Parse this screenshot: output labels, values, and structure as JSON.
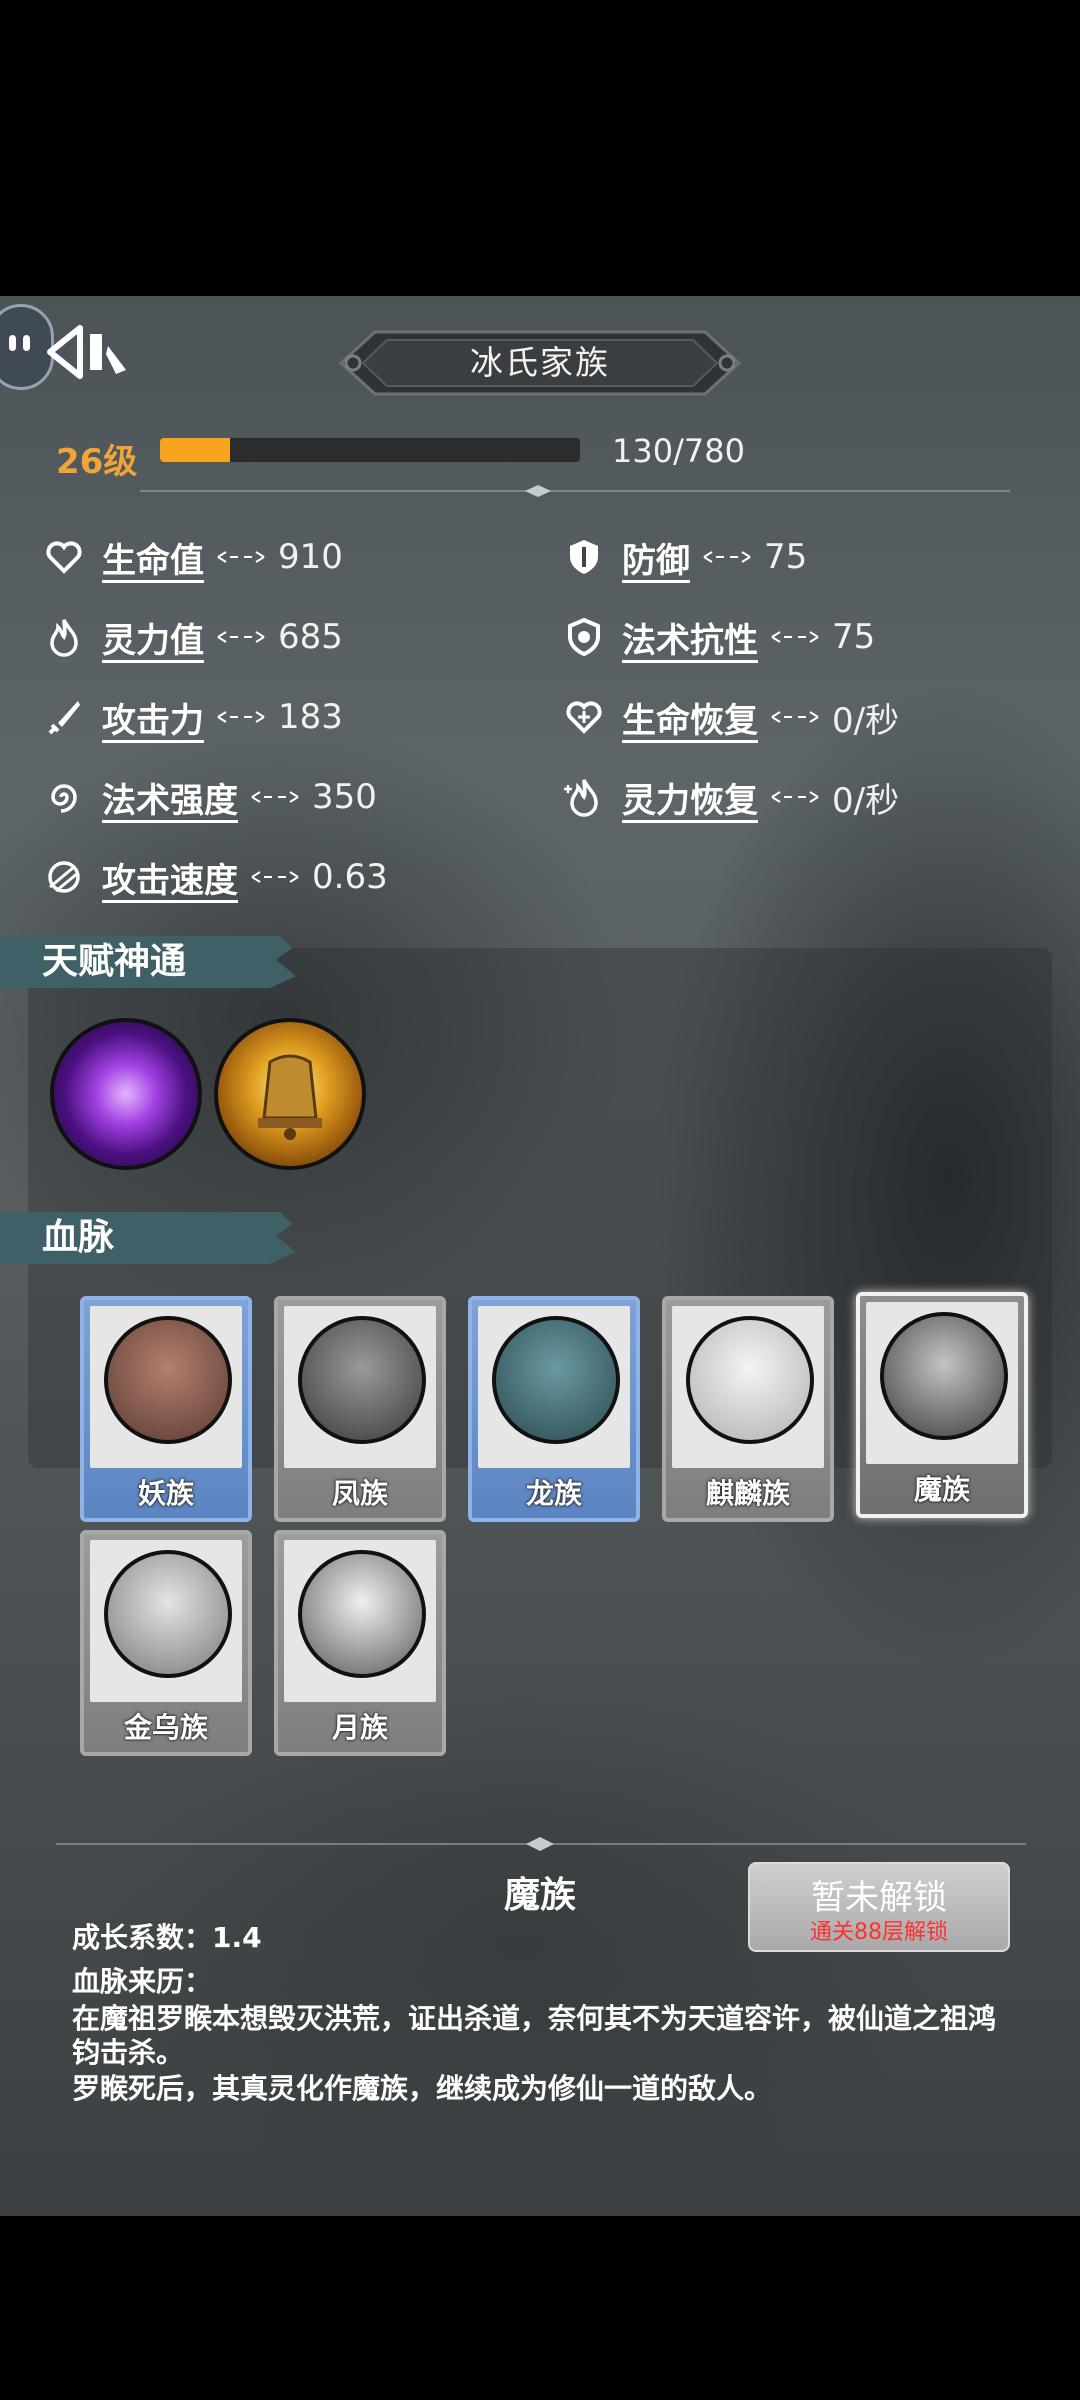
{
  "header": {
    "title": "冰氏家族"
  },
  "level": {
    "label": "26级",
    "xp_text": "130/780",
    "xp_current": 130,
    "xp_max": 780
  },
  "stats": [
    {
      "name": "生命值",
      "value": "910",
      "icon": "heart-icon"
    },
    {
      "name": "防御",
      "value": "75",
      "icon": "shield-icon"
    },
    {
      "name": "灵力值",
      "value": "685",
      "icon": "flame-icon"
    },
    {
      "name": "法术抗性",
      "value": "75",
      "icon": "magic-shield-icon"
    },
    {
      "name": "攻击力",
      "value": "183",
      "icon": "sword-icon"
    },
    {
      "name": "生命恢复",
      "value": "0/秒",
      "icon": "heart-regen-icon"
    },
    {
      "name": "法术强度",
      "value": "350",
      "icon": "spiral-icon"
    },
    {
      "name": "灵力恢复",
      "value": "0/秒",
      "icon": "flame-regen-icon"
    },
    {
      "name": "攻击速度",
      "value": "0.63",
      "icon": "speed-icon"
    }
  ],
  "talent_section": {
    "title": "天赋神通",
    "skills": [
      "purple-vortex-icon",
      "golden-bell-icon"
    ]
  },
  "bloodline_section": {
    "title": "血脉",
    "cards": [
      {
        "name": "妖族",
        "style": "blue"
      },
      {
        "name": "凤族",
        "style": "gray"
      },
      {
        "name": "龙族",
        "style": "blue"
      },
      {
        "name": "麒麟族",
        "style": "gray"
      },
      {
        "name": "魔族",
        "style": "selected"
      },
      {
        "name": "金乌族",
        "style": "gray"
      },
      {
        "name": "月族",
        "style": "gray"
      }
    ]
  },
  "detail": {
    "title": "魔族",
    "lock_label": "暂未解锁",
    "lock_sub": "通关88层解锁",
    "growth": "成长系数：1.4",
    "origin_label": "血脉来历：",
    "origin_text_1": "在魔祖罗睺本想毁灭洪荒，证出杀道，奈何其不为天道容许，被仙道之祖鸿钧击杀。",
    "origin_text_2": "罗睺死后，其真灵化作魔族，继续成为修仙一道的敌人。"
  },
  "colors": {
    "level": "#f0a43a",
    "xp_fill": "#f7a41e",
    "lock_sub": "#ff3030",
    "card_blue": "#7fa3d6"
  }
}
